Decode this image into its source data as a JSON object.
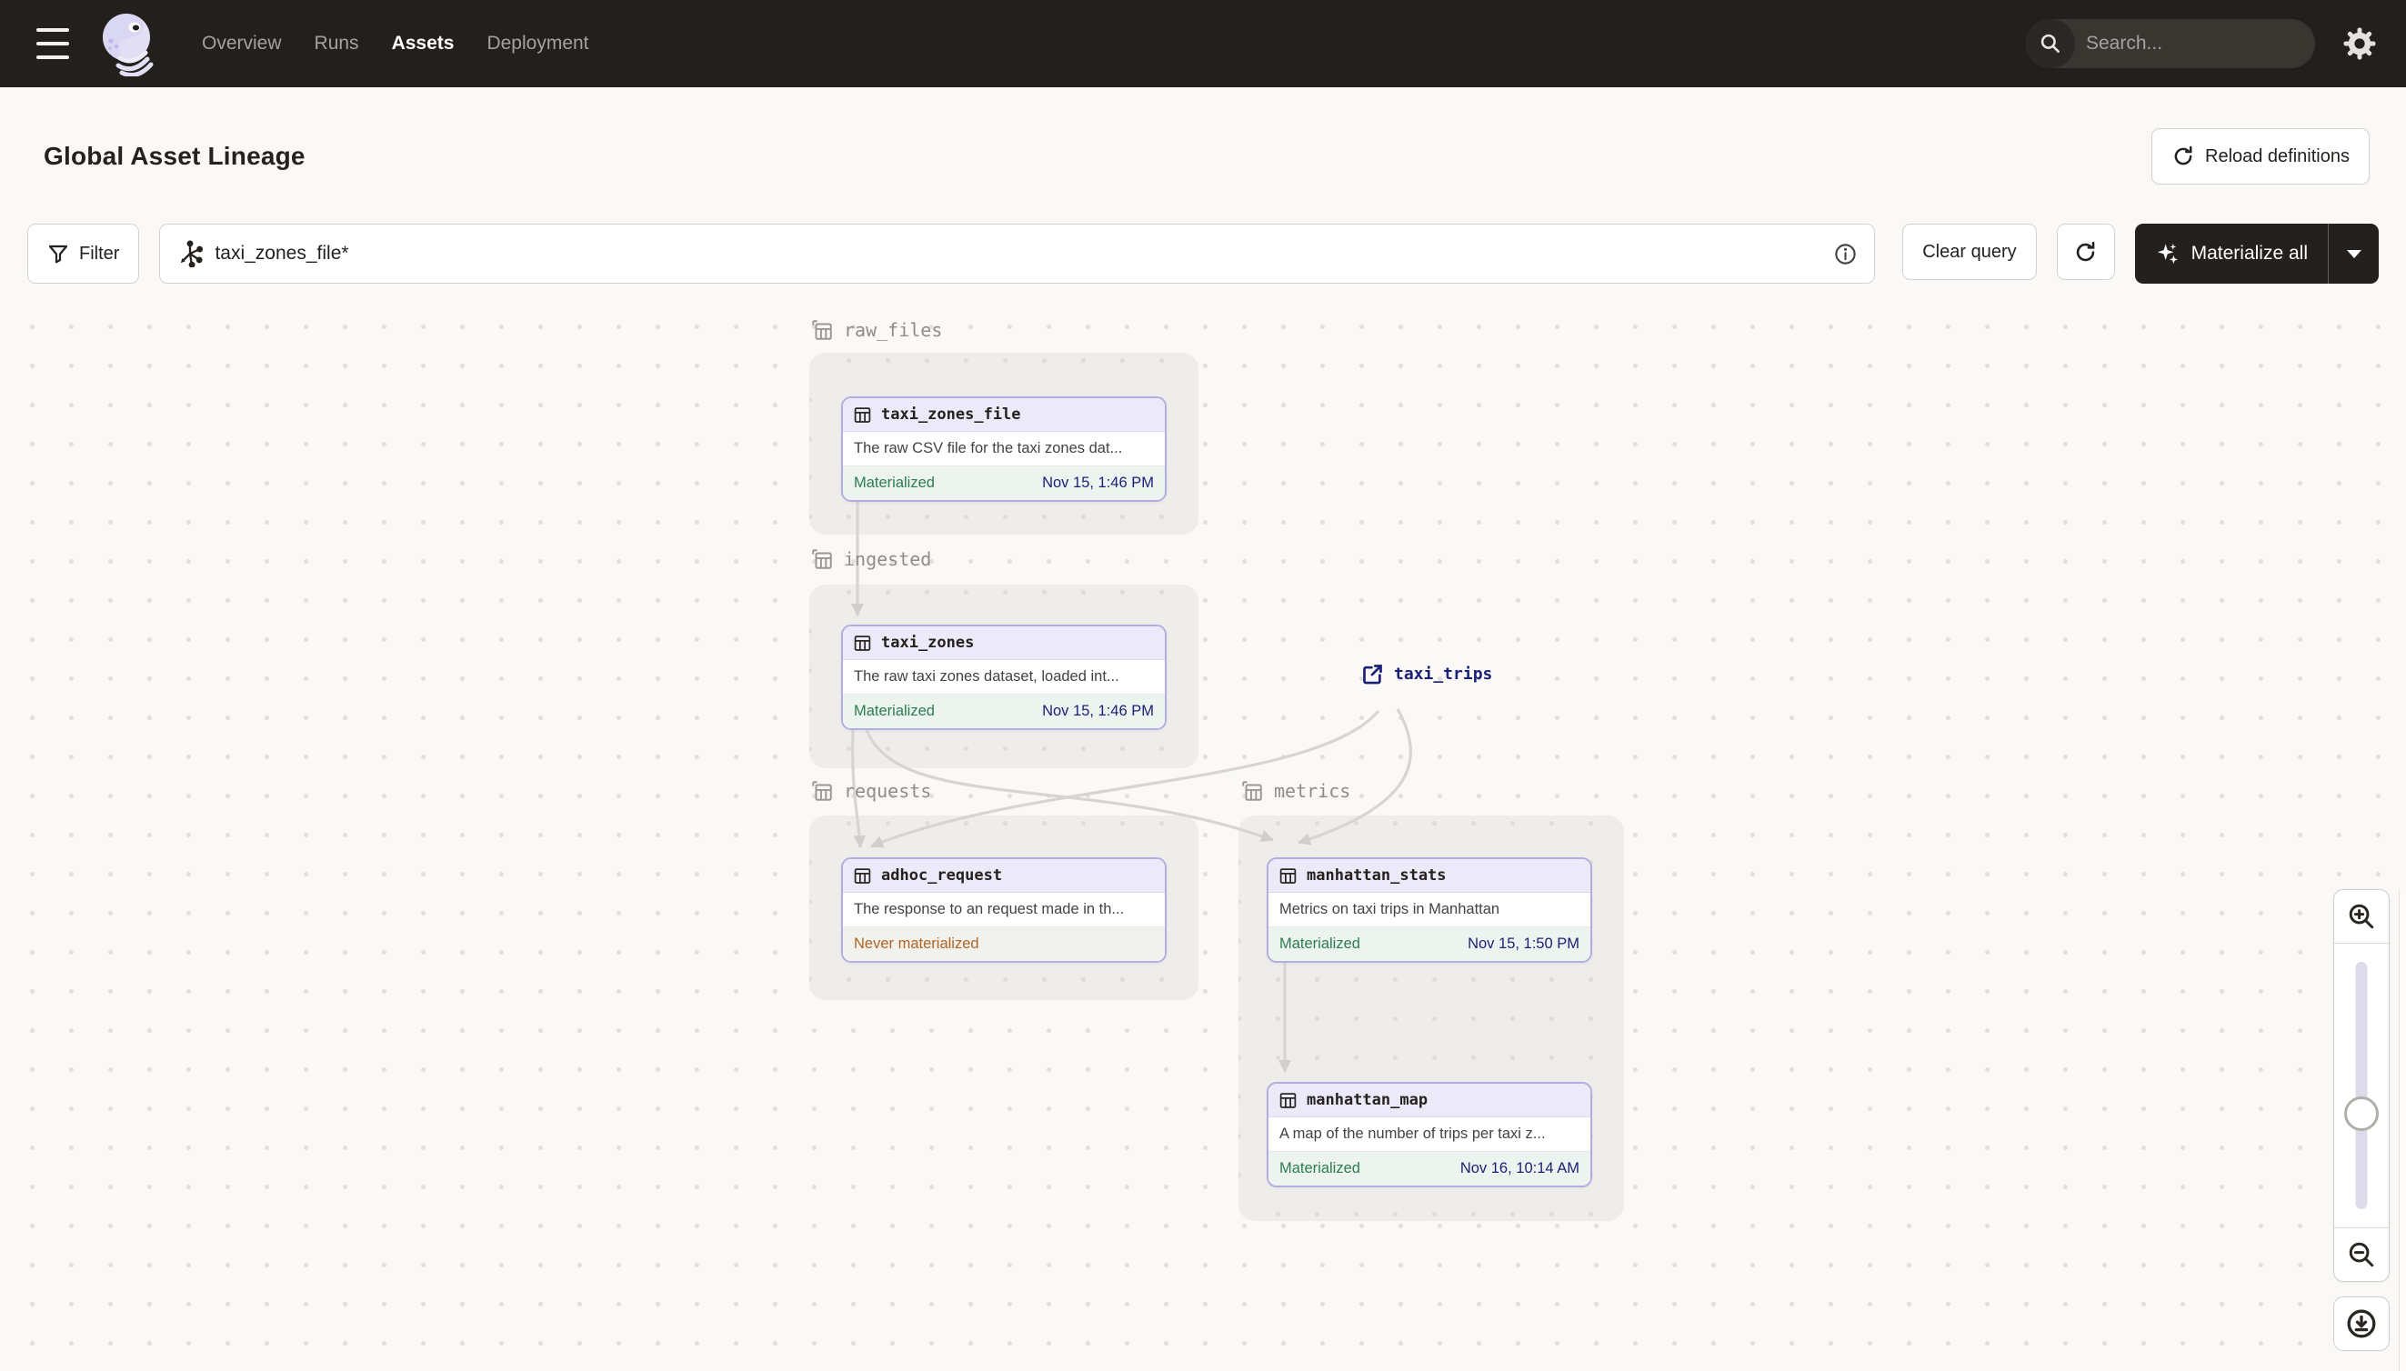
{
  "topnav": {
    "items": [
      {
        "label": "Overview",
        "active": false
      },
      {
        "label": "Runs",
        "active": false
      },
      {
        "label": "Assets",
        "active": true
      },
      {
        "label": "Deployment",
        "active": false
      }
    ],
    "search_placeholder": "Search...",
    "search_shortcut": "/"
  },
  "header": {
    "title": "Global Asset Lineage",
    "reload_label": "Reload definitions"
  },
  "toolbar": {
    "filter_label": "Filter",
    "query_value": "taxi_zones_file*",
    "clear_label": "Clear query",
    "materialize_label": "Materialize all"
  },
  "graph": {
    "groups": [
      {
        "name": "raw_files"
      },
      {
        "name": "ingested"
      },
      {
        "name": "requests"
      },
      {
        "name": "metrics"
      }
    ],
    "nodes": [
      {
        "title": "taxi_zones_file",
        "desc": "The raw CSV file for the taxi zones dat...",
        "status": "Materialized",
        "timestamp": "Nov 15, 1:46 PM"
      },
      {
        "title": "taxi_zones",
        "desc": "The raw taxi zones dataset, loaded int...",
        "status": "Materialized",
        "timestamp": "Nov 15, 1:46 PM"
      },
      {
        "title": "adhoc_request",
        "desc": "The response to an request made in th...",
        "status": "Never materialized",
        "timestamp": ""
      },
      {
        "title": "manhattan_stats",
        "desc": "Metrics on taxi trips in Manhattan",
        "status": "Materialized",
        "timestamp": "Nov 15, 1:50 PM"
      },
      {
        "title": "manhattan_map",
        "desc": "A map of the number of trips per taxi z...",
        "status": "Materialized",
        "timestamp": "Nov 16, 10:14 AM"
      }
    ],
    "external_asset": {
      "label": "taxi_trips"
    }
  },
  "icons": {
    "menu": "hamburger",
    "logo": "dagster-octopus",
    "search": "magnifier",
    "settings": "gear",
    "reload": "circular-arrow",
    "filter": "funnel",
    "selection": "asterisk-graph",
    "info": "info-circle",
    "materialize": "sparkles",
    "asset": "table-grid",
    "group": "layered-table",
    "external": "arrow-out-box",
    "zoom_in": "magnifier-plus",
    "zoom_out": "magnifier-minus",
    "recenter": "download-circle"
  },
  "colors": {
    "topbar_bg": "#231F1C",
    "page_bg": "#FAF9F7",
    "node_border": "#B4ADE2",
    "node_header_bg": "#ECEAF8",
    "materialized_green": "#2B7D52",
    "never_materialized_amber": "#B06522",
    "timestamp_navy": "#1C2178",
    "edge_gray": "#D8D5D1",
    "group_bg": "#EFEDEA"
  }
}
